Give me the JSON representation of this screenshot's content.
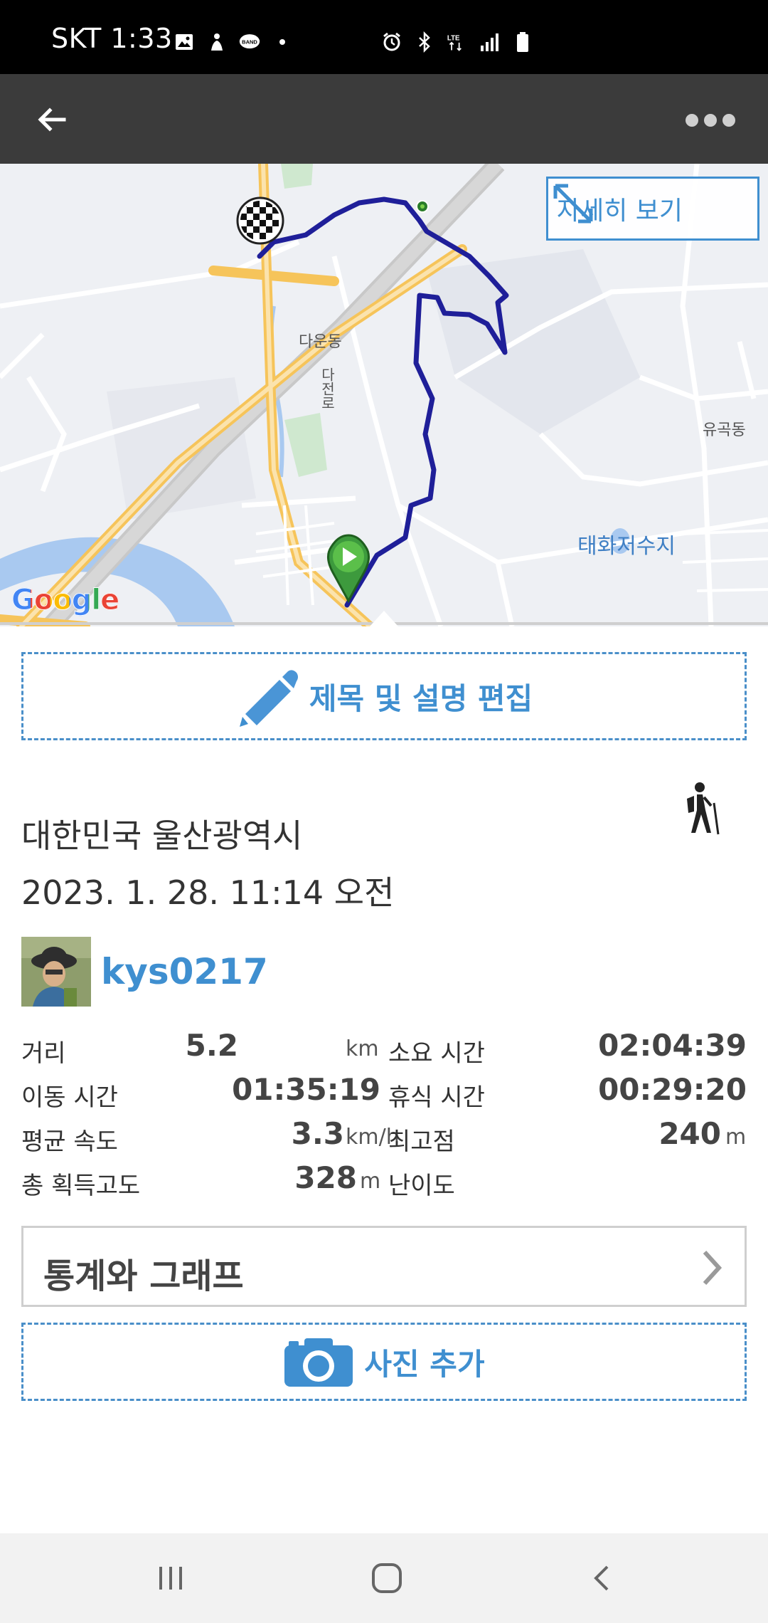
{
  "status_bar": {
    "carrier_time": "SKT 1:33",
    "notification_icons": [
      "image-icon",
      "hand-icon",
      "band-icon",
      "dot-icon"
    ],
    "system_icons": [
      "alarm-icon",
      "bluetooth-icon",
      "lte-icon",
      "signal-icon",
      "battery-icon"
    ]
  },
  "app_bar": {
    "back_icon": "arrow-left-icon",
    "more_icon": "more-dots-icon"
  },
  "map": {
    "detail_button_label": "자세히 보기",
    "google_logo": "Google",
    "labels": {
      "dawoon": "다운동",
      "dajeonro": "다전로",
      "yugok": "유곡동",
      "reservoir": "태화저수지"
    },
    "colors": {
      "route": "#1f1f99",
      "road": "#f6c45a",
      "water": "#a9c9f0"
    }
  },
  "edit_button_label": "제목 및 설명 편집",
  "location": "대한민국 울산광역시",
  "datetime": "2023. 1. 28. 11:14 오전",
  "activity_icon": "hiking-icon",
  "user": {
    "name": "kys0217"
  },
  "stats": {
    "distance": {
      "label": "거리",
      "value": "5.2",
      "unit": "km"
    },
    "duration": {
      "label": "소요 시간",
      "value": "02:04:39"
    },
    "moving_time": {
      "label": "이동 시간",
      "value": "01:35:19"
    },
    "rest_time": {
      "label": "휴식 시간",
      "value": "00:29:20"
    },
    "avg_speed": {
      "label": "평균 속도",
      "value": "3.3",
      "unit": "km/h"
    },
    "highest_point": {
      "label": "최고점",
      "value": "240",
      "unit": "m"
    },
    "elevation_gain": {
      "label": "총 획득고도",
      "value": "328",
      "unit": "m"
    },
    "difficulty": {
      "label": "난이도"
    }
  },
  "stats_graph_label": "통계와 그래프",
  "photo_button_label": "사진 추가",
  "colors": {
    "accent": "#3f8fd0",
    "appbar": "#3b3b3b"
  }
}
